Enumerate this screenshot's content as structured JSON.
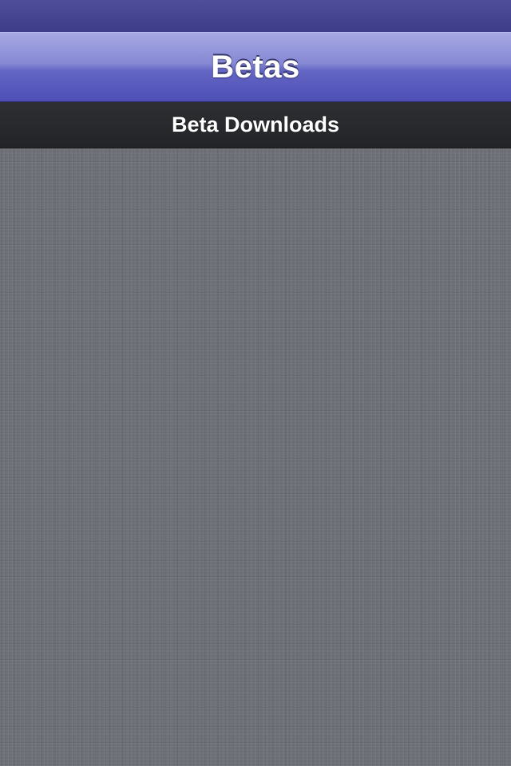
{
  "nav": {
    "title": "Betas"
  },
  "section": {
    "header": "Beta Downloads"
  },
  "colors": {
    "nav_bar": "#6466c4",
    "status_bar": "#3d3c88",
    "section_header": "#232427",
    "background": "#6f7179"
  }
}
